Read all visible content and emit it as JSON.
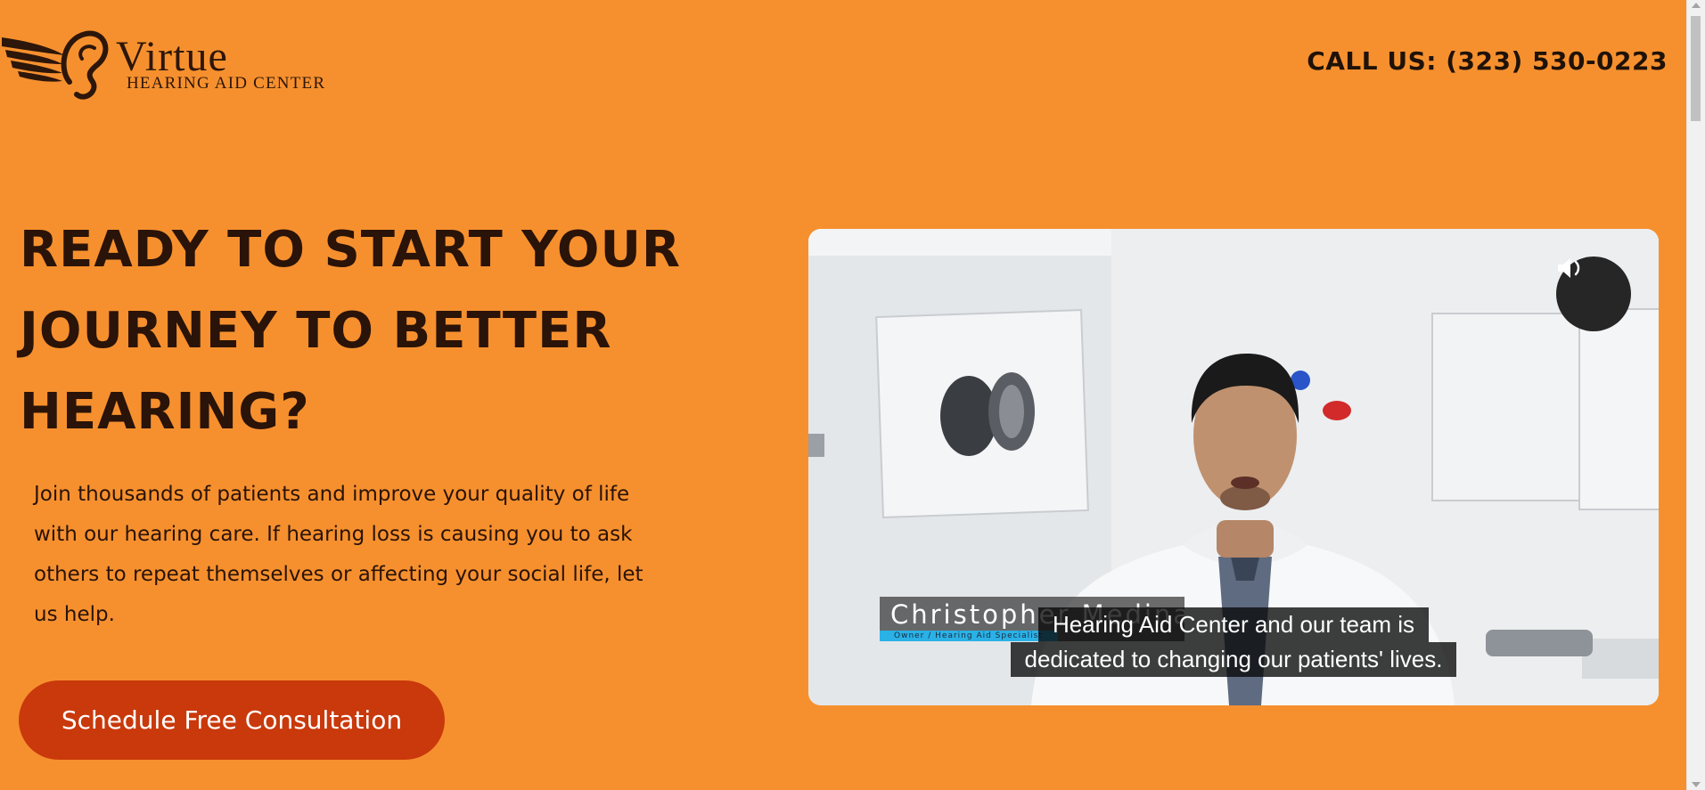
{
  "header": {
    "logo_name": "Virtue",
    "logo_subtitle": "HEARING AID CENTER",
    "call_text": "CALL US: (323) 530-0223"
  },
  "hero": {
    "headline_lines": [
      "READY TO START YOUR",
      "JOURNEY TO BETTER",
      "HEARING?"
    ],
    "intro_lines": [
      "Join thousands of patients and improve your quality of life",
      "with our hearing care. If hearing loss is causing you to ask",
      "others to repeat themselves or affecting your social life, let",
      "us help."
    ],
    "cta_label": "Schedule Free Consultation"
  },
  "video": {
    "speaker_name": "Christopher Medina",
    "speaker_role": "Owner / Hearing Aid Specialist",
    "caption_lines": [
      "Hearing Aid Center and our team is",
      "dedicated to changing our patients' lives."
    ],
    "mute_icon": "speaker-volume-icon"
  },
  "colors": {
    "background": "#f6902e",
    "text_dark": "#2a1308",
    "cta_background": "#c9390b",
    "name_accent": "#2ab1e6"
  }
}
